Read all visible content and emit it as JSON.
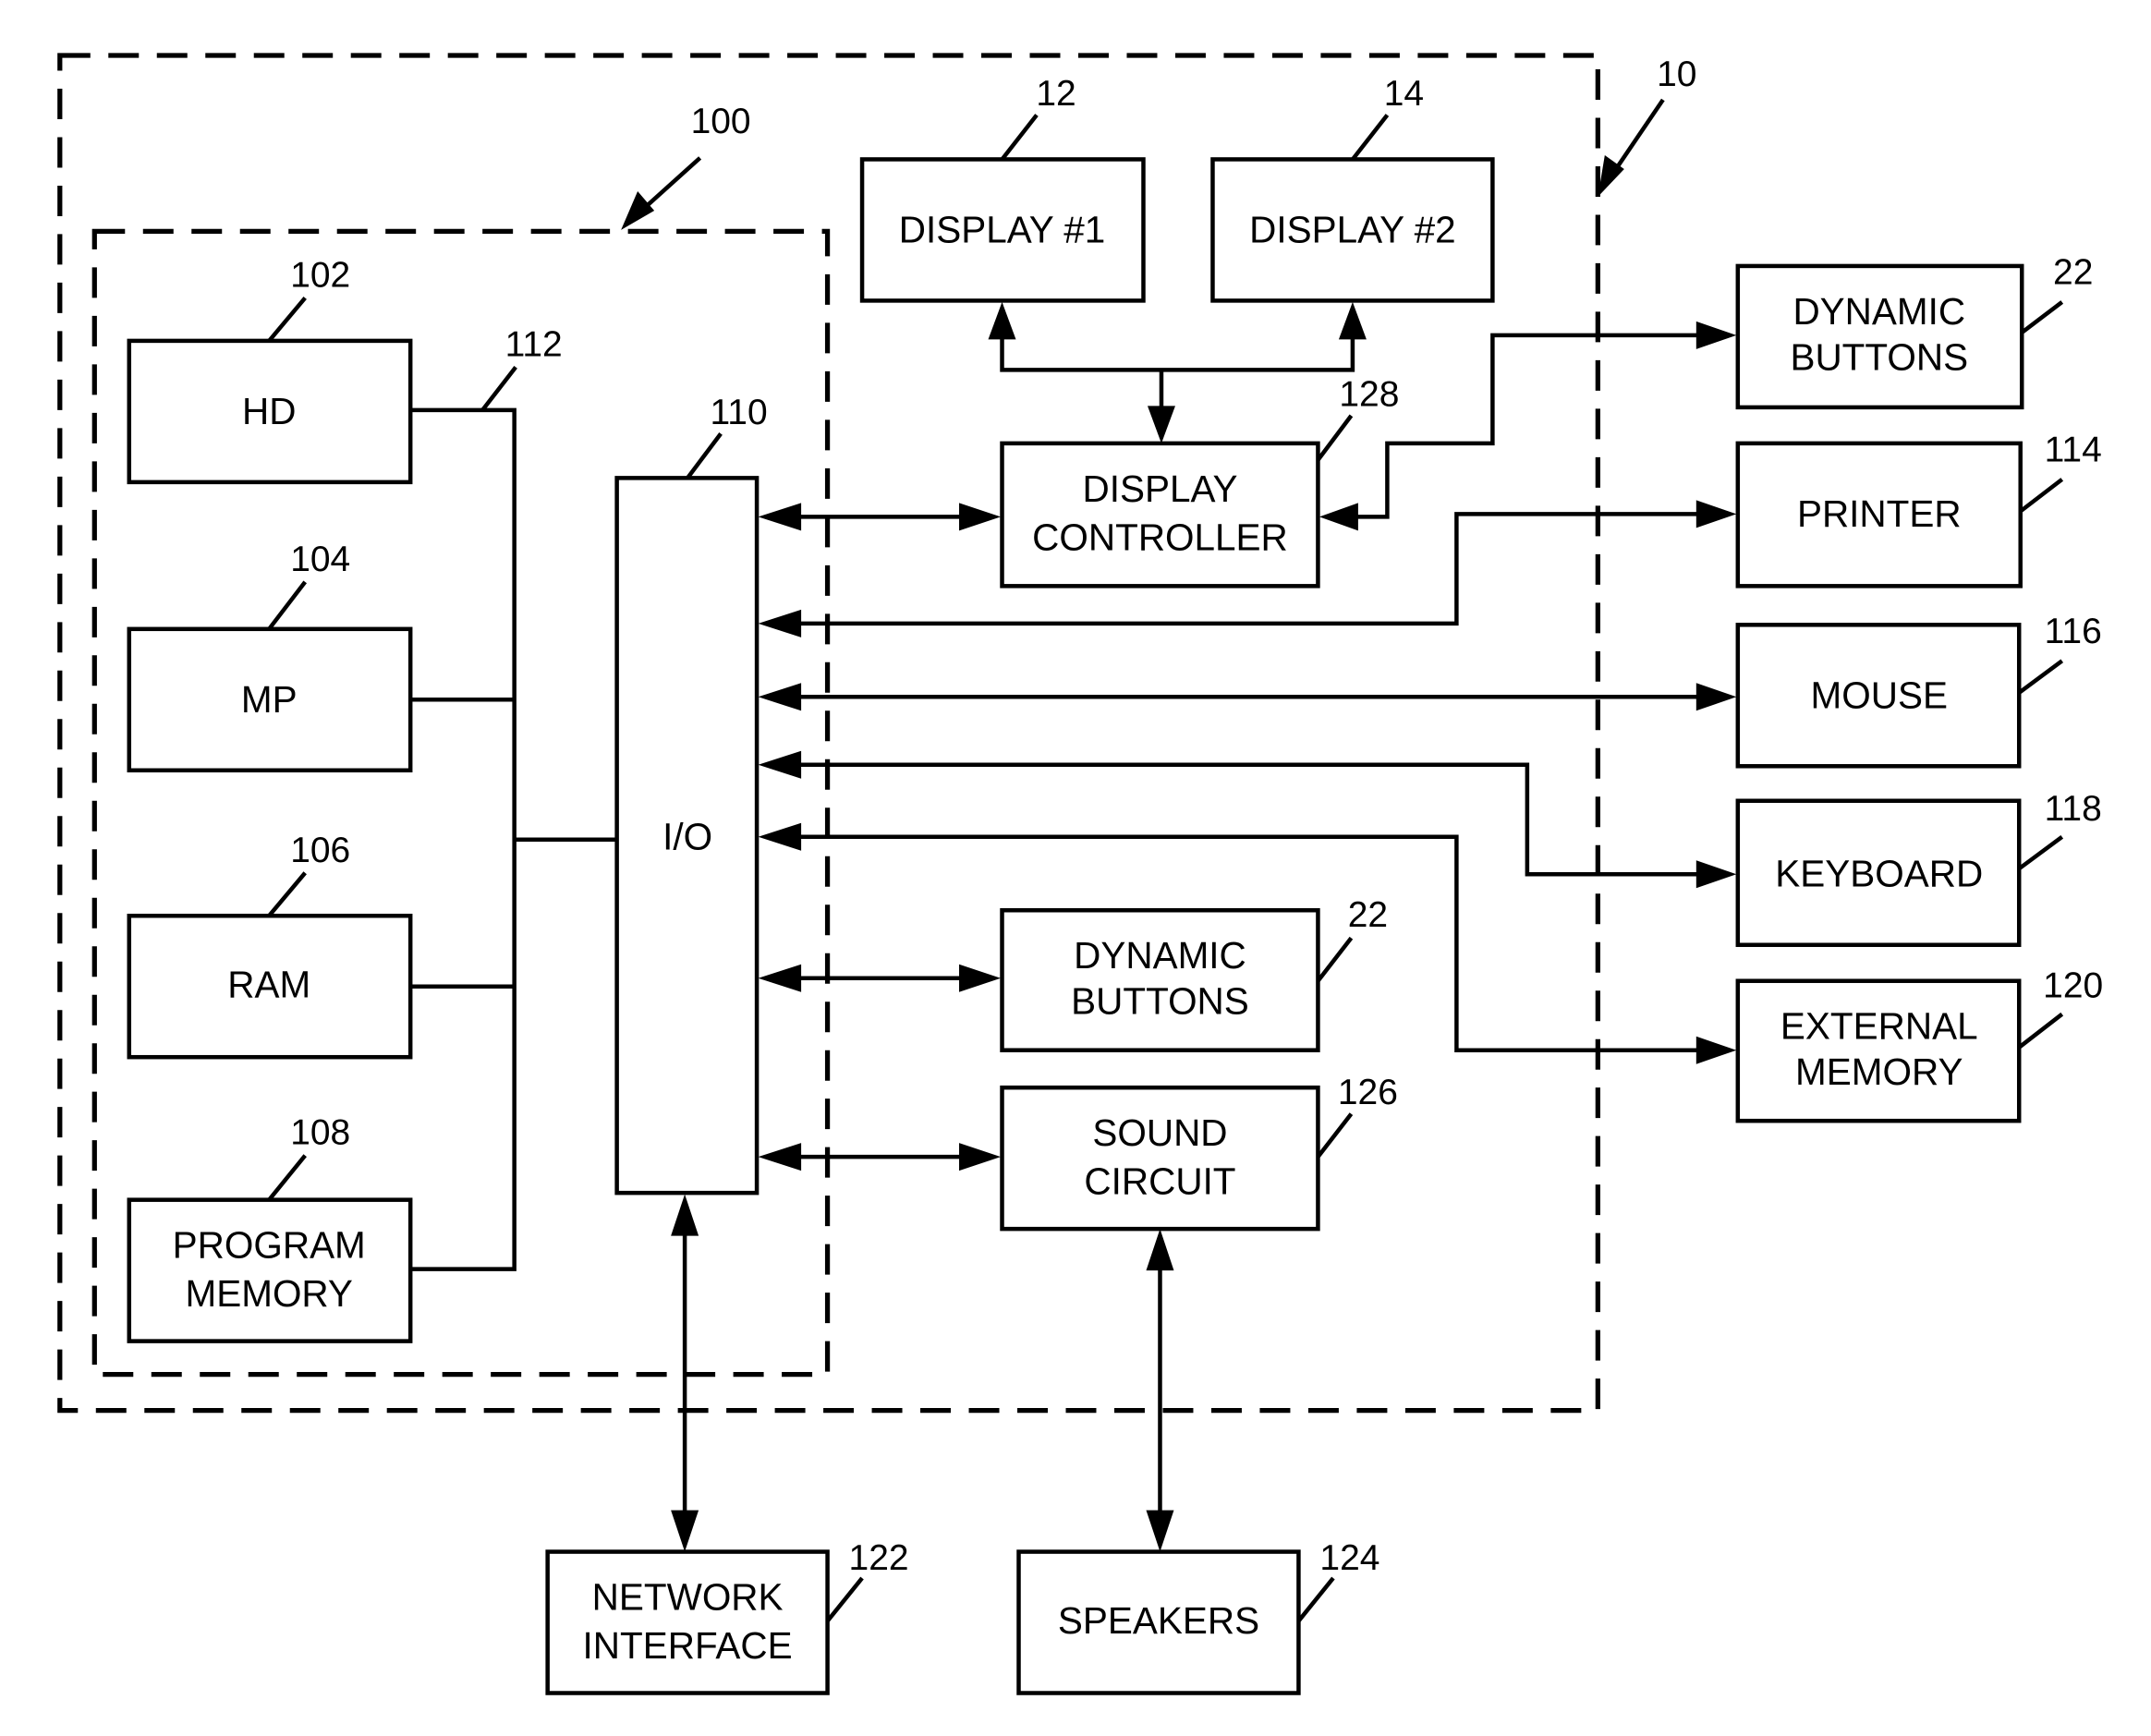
{
  "diagram": {
    "groups": {
      "system": {
        "ref": "10"
      },
      "computer": {
        "ref": "100"
      }
    },
    "blocks": {
      "hd": {
        "ref": "102",
        "lines": [
          "HD"
        ]
      },
      "mp": {
        "ref": "104",
        "lines": [
          "MP"
        ]
      },
      "ram": {
        "ref": "106",
        "lines": [
          "RAM"
        ]
      },
      "program_memory": {
        "ref": "108",
        "lines": [
          "PROGRAM",
          "MEMORY"
        ]
      },
      "io": {
        "ref": "110",
        "lines": [
          "I/O"
        ]
      },
      "display1": {
        "ref": "12",
        "lines": [
          "DISPLAY #1"
        ]
      },
      "display2": {
        "ref": "14",
        "lines": [
          "DISPLAY #2"
        ]
      },
      "display_controller": {
        "ref": "128",
        "lines": [
          "DISPLAY",
          "CONTROLLER"
        ]
      },
      "dynamic_buttons_internal": {
        "ref": "22",
        "lines": [
          "DYNAMIC",
          "BUTTONS"
        ]
      },
      "sound_circuit": {
        "ref": "126",
        "lines": [
          "SOUND",
          "CIRCUIT"
        ]
      },
      "dynamic_buttons_external": {
        "ref": "22",
        "lines": [
          "DYNAMIC",
          "BUTTONS"
        ]
      },
      "printer": {
        "ref": "114",
        "lines": [
          "PRINTER"
        ]
      },
      "mouse": {
        "ref": "116",
        "lines": [
          "MOUSE"
        ]
      },
      "keyboard": {
        "ref": "118",
        "lines": [
          "KEYBOARD"
        ]
      },
      "external_memory": {
        "ref": "120",
        "lines": [
          "EXTERNAL",
          "MEMORY"
        ]
      },
      "network_interface": {
        "ref": "122",
        "lines": [
          "NETWORK",
          "INTERFACE"
        ]
      },
      "speakers": {
        "ref": "124",
        "lines": [
          "SPEAKERS"
        ]
      }
    },
    "bus": {
      "ref": "112"
    }
  }
}
